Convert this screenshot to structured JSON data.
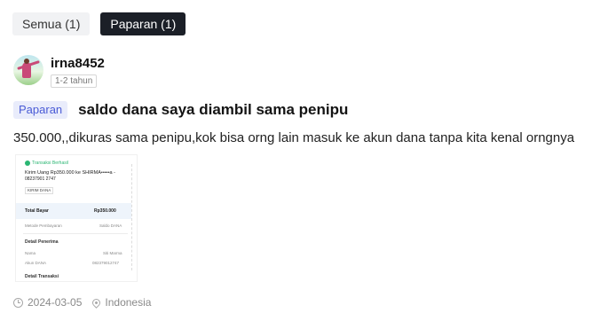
{
  "tabs": [
    {
      "label": "Semua (1)",
      "active": false
    },
    {
      "label": "Paparan (1)",
      "active": true
    }
  ],
  "review": {
    "username": "irna8452",
    "tenure": "1-2 tahun",
    "tag": "Paparan",
    "title": "saldo dana saya diambil sama penipu",
    "body": "350.000,,dikuras sama penipu,kok bisa orng lain masuk ke akun dana tanpa kita kenal orngnya",
    "date": "2024-03-05",
    "location": "Indonesia"
  },
  "attachment": {
    "status": "Transaksi Berhasil",
    "heading": "Kirim Uang Rp350.000 ke SHIRMA•••••a -",
    "account_line": "08237901 2747",
    "badge": "KIRIM DANA",
    "total_label": "Total Bayar",
    "total_value": "Rp350.000",
    "method_label": "Metode Pembayaran",
    "method_value": "Saldo DANA",
    "recipient_header": "Detail Penerima",
    "name_label": "Nama",
    "name_value": "Siti Marma",
    "account_label": "Akun DANA",
    "account_value": "082379012747",
    "transaction_header": "Detail Transaksi"
  },
  "colors": {
    "active_tab_bg": "#1b1f27",
    "tag_text": "#4a5bd6",
    "tag_bg": "#e9ecfb"
  },
  "icons": {
    "date": "clock-icon",
    "location": "pin-icon"
  }
}
